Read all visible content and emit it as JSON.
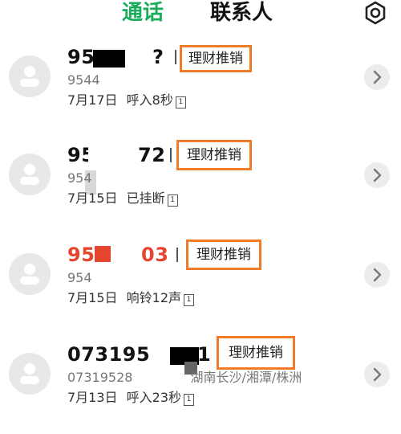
{
  "header": {
    "tabs": [
      {
        "label": "通话",
        "active": true
      },
      {
        "label": "联系人",
        "active": false
      }
    ],
    "settings_icon": "gear-icon",
    "accent_color": "#1aad5b"
  },
  "calls": [
    {
      "number": "95",
      "number_tail": "?",
      "tag": "理财推销",
      "sub": "9544",
      "date": "7月17日",
      "status": "呼入8秒",
      "sim": "1",
      "missed": false
    },
    {
      "number": "95",
      "number_tail": "72",
      "tag": "理财推销",
      "sub": "954",
      "date": "7月15日",
      "status": "已挂断",
      "sim": "1",
      "missed": false
    },
    {
      "number": "95",
      "number_tail": "03",
      "tag": "理财推销",
      "sub": "954",
      "date": "7月15日",
      "status": "响铃12声",
      "sim": "1",
      "missed": true
    },
    {
      "number": "073195",
      "number_tail": "1",
      "tag": "理财推销",
      "sub": "07319528",
      "sub_location": "湖南长沙/湘潭/株洲",
      "date": "7月13日",
      "status": "呼入23秒",
      "sim": "1",
      "missed": false
    }
  ],
  "colors": {
    "missed": "#e5462f",
    "tag_border": "#f07c2a"
  }
}
